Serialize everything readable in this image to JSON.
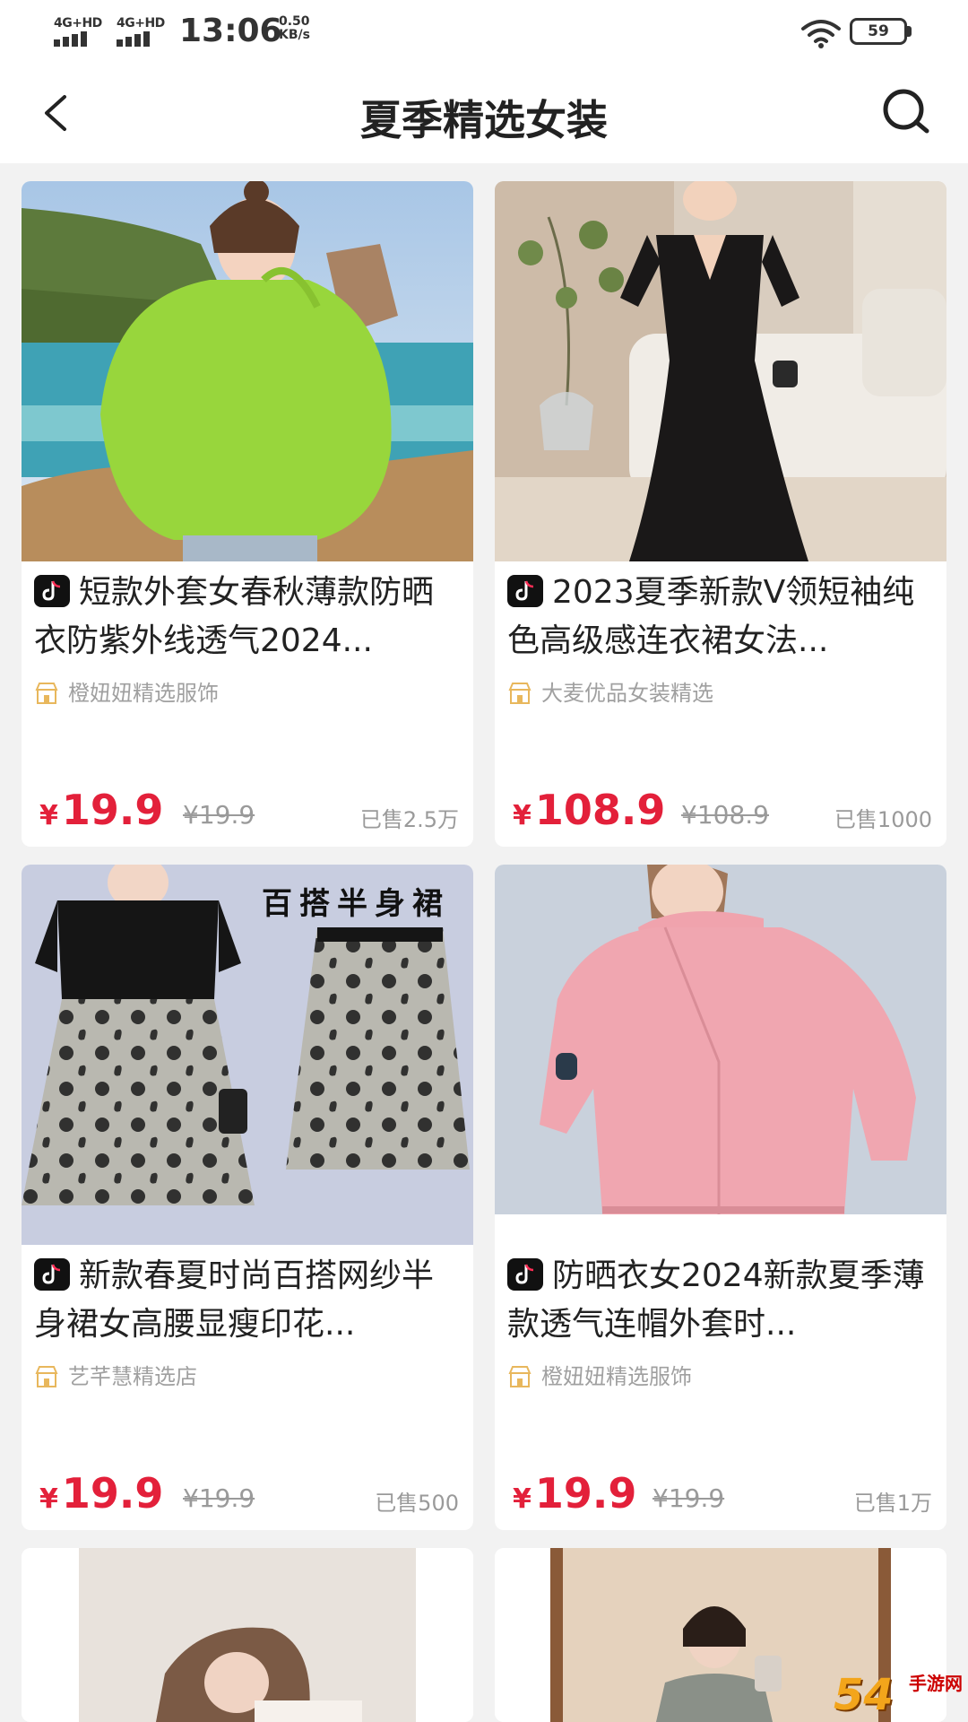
{
  "status_bar": {
    "signal1": "4G+HD",
    "signal2": "4G+HD",
    "time": "13:06",
    "net_speed_value": "0.50",
    "net_speed_unit": "KB/s",
    "battery": "59"
  },
  "header": {
    "title": "夏季精选女装"
  },
  "colors": {
    "price_red": "#e3203a",
    "muted_text": "#9a9a9a",
    "background": "#f2f2f2"
  },
  "products": [
    {
      "title": "短款外套女春秋薄款防晒衣防紫外线透气2024...",
      "shop": "橙妞妞精选服饰",
      "price_symbol": "¥",
      "price": "19.9",
      "original_price": "¥19.9",
      "sold": "已售2.5万"
    },
    {
      "title": "2023夏季新款V领短袖纯色高级感连衣裙女法...",
      "shop": "大麦优品女装精选",
      "price_symbol": "¥",
      "price": "108.9",
      "original_price": "¥108.9",
      "sold": "已售1000"
    },
    {
      "title": "新款春夏时尚百搭网纱半身裙女高腰显瘦印花...",
      "shop": "艺芊慧精选店",
      "price_symbol": "¥",
      "price": "19.9",
      "original_price": "¥19.9",
      "sold": "已售500",
      "image_caption": "百搭半身裙"
    },
    {
      "title": "防晒衣女2024新款夏季薄款透气连帽外套时...",
      "shop": "橙妞妞精选服饰",
      "price_symbol": "¥",
      "price": "19.9",
      "original_price": "¥19.9",
      "sold": "已售1万"
    }
  ],
  "watermark": {
    "big": "54",
    "small": "手游网"
  }
}
